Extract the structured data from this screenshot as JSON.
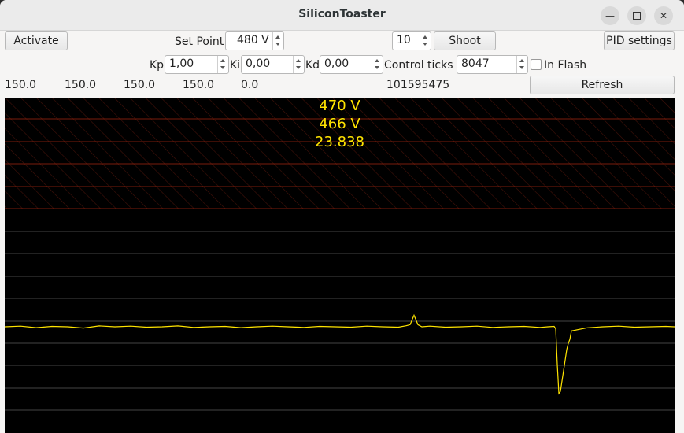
{
  "window": {
    "title": "SiliconToaster"
  },
  "toolbar": {
    "activate_label": "Activate",
    "set_point_label": "Set Point",
    "set_point_value": "480 V",
    "shots_value": "10",
    "shoot_label": "Shoot",
    "pid_settings_label": "PID settings"
  },
  "pid": {
    "kp_label": "Kp",
    "kp_value": "1,00",
    "ki_label": "Ki",
    "ki_value": "0,00",
    "kd_label": "Kd",
    "kd_value": "0,00",
    "control_ticks_label": "Control ticks",
    "control_ticks_value": "8047",
    "in_flash_label": "In Flash",
    "in_flash_checked": false
  },
  "stats": {
    "values": [
      "150.0",
      "150.0",
      "150.0",
      "150.0",
      "0.0"
    ],
    "counter": "101595475",
    "refresh_label": "Refresh"
  },
  "readout": {
    "line1": "470 V",
    "line2": "466 V",
    "line3": "23.838",
    "color": "#ffe400"
  },
  "chart_data": {
    "type": "line",
    "grid": true,
    "trace_color": "#ffe400",
    "series": [
      {
        "x": [
          0,
          20,
          40,
          60,
          80,
          100,
          120,
          140,
          160,
          180,
          200,
          220,
          240,
          260,
          280,
          300,
          320,
          340,
          360,
          380,
          400,
          420,
          440,
          460,
          480,
          500,
          510,
          515,
          520,
          525,
          530,
          540,
          560,
          580,
          600,
          620,
          640,
          660,
          680,
          690,
          698,
          700,
          702,
          704,
          706,
          708,
          710,
          712,
          714,
          716,
          718,
          720,
          740,
          760,
          780,
          800,
          820,
          840,
          851
        ],
        "y": [
          0,
          0.3,
          -0.4,
          0.2,
          0,
          -0.6,
          0.4,
          0,
          0.3,
          -0.2,
          0,
          0.4,
          -0.3,
          0,
          0.2,
          -0.4,
          0,
          0.3,
          0,
          -0.3,
          0.2,
          0,
          -0.2,
          0.3,
          0,
          -0.2,
          0.5,
          1,
          5.5,
          1,
          0,
          0.3,
          -0.2,
          0,
          0.3,
          -0.3,
          0,
          0.2,
          -0.3,
          0,
          0.2,
          -1,
          -18,
          -32,
          -31,
          -26,
          -21,
          -16,
          -11,
          -8,
          -6,
          -2,
          -0.5,
          0,
          0.3,
          -0.2,
          0,
          0.2,
          0
        ]
      }
    ]
  }
}
